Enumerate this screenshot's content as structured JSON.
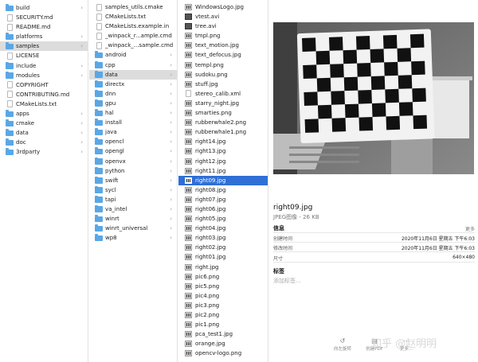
{
  "column1": [
    {
      "label": "build",
      "icon": "folder",
      "chevron": true
    },
    {
      "label": "SECURITY.md",
      "icon": "doc"
    },
    {
      "label": "README.md",
      "icon": "doc"
    },
    {
      "label": "platforms",
      "icon": "folder",
      "chevron": true
    },
    {
      "label": "samples",
      "icon": "folder",
      "chevron": true,
      "selected": "grey"
    },
    {
      "label": "LICENSE",
      "icon": "doc"
    },
    {
      "label": "include",
      "icon": "folder",
      "chevron": true
    },
    {
      "label": "modules",
      "icon": "folder",
      "chevron": true
    },
    {
      "label": "COPYRIGHT",
      "icon": "doc"
    },
    {
      "label": "CONTRIBUTING.md",
      "icon": "doc"
    },
    {
      "label": "CMakeLists.txt",
      "icon": "doc"
    },
    {
      "label": "apps",
      "icon": "folder",
      "chevron": true
    },
    {
      "label": "cmake",
      "icon": "folder",
      "chevron": true
    },
    {
      "label": "data",
      "icon": "folder",
      "chevron": true
    },
    {
      "label": "doc",
      "icon": "folder",
      "chevron": true
    },
    {
      "label": "3rdparty",
      "icon": "folder",
      "chevron": true
    }
  ],
  "column2": [
    {
      "label": "samples_utils.cmake",
      "icon": "doc"
    },
    {
      "label": "CMakeLists.txt",
      "icon": "doc"
    },
    {
      "label": "CMakeLists.example.in",
      "icon": "doc"
    },
    {
      "label": "_winpack_r...ample.cmd",
      "icon": "doc"
    },
    {
      "label": "_winpack_...sample.cmd",
      "icon": "doc"
    },
    {
      "label": "android",
      "icon": "folder",
      "chevron": true
    },
    {
      "label": "cpp",
      "icon": "folder",
      "chevron": true
    },
    {
      "label": "data",
      "icon": "folder",
      "chevron": true,
      "selected": "grey"
    },
    {
      "label": "directx",
      "icon": "folder",
      "chevron": true
    },
    {
      "label": "dnn",
      "icon": "folder",
      "chevron": true
    },
    {
      "label": "gpu",
      "icon": "folder",
      "chevron": true
    },
    {
      "label": "hal",
      "icon": "folder",
      "chevron": true
    },
    {
      "label": "install",
      "icon": "folder",
      "chevron": true
    },
    {
      "label": "java",
      "icon": "folder",
      "chevron": true
    },
    {
      "label": "opencl",
      "icon": "folder",
      "chevron": true
    },
    {
      "label": "opengl",
      "icon": "folder",
      "chevron": true
    },
    {
      "label": "openvx",
      "icon": "folder",
      "chevron": true
    },
    {
      "label": "python",
      "icon": "folder",
      "chevron": true
    },
    {
      "label": "swift",
      "icon": "folder",
      "chevron": true
    },
    {
      "label": "sycl",
      "icon": "folder",
      "chevron": true
    },
    {
      "label": "tapi",
      "icon": "folder",
      "chevron": true
    },
    {
      "label": "va_intel",
      "icon": "folder",
      "chevron": true
    },
    {
      "label": "winrt",
      "icon": "folder",
      "chevron": true
    },
    {
      "label": "winrt_universal",
      "icon": "folder",
      "chevron": true
    },
    {
      "label": "wp8",
      "icon": "folder",
      "chevron": true
    }
  ],
  "column3": [
    {
      "label": "WindowsLogo.jpg",
      "icon": "img"
    },
    {
      "label": "vtest.avi",
      "icon": "vid"
    },
    {
      "label": "tree.avi",
      "icon": "vid"
    },
    {
      "label": "tmpl.png",
      "icon": "img"
    },
    {
      "label": "text_motion.jpg",
      "icon": "img"
    },
    {
      "label": "text_defocus.jpg",
      "icon": "img"
    },
    {
      "label": "templ.png",
      "icon": "img"
    },
    {
      "label": "sudoku.png",
      "icon": "img"
    },
    {
      "label": "stuff.jpg",
      "icon": "img"
    },
    {
      "label": "stereo_calib.xml",
      "icon": "doc"
    },
    {
      "label": "starry_night.jpg",
      "icon": "img"
    },
    {
      "label": "smarties.png",
      "icon": "img"
    },
    {
      "label": "rubberwhale2.png",
      "icon": "img"
    },
    {
      "label": "rubberwhale1.png",
      "icon": "img"
    },
    {
      "label": "right14.jpg",
      "icon": "img"
    },
    {
      "label": "right13.jpg",
      "icon": "img"
    },
    {
      "label": "right12.jpg",
      "icon": "img"
    },
    {
      "label": "right11.jpg",
      "icon": "img"
    },
    {
      "label": "right09.jpg",
      "icon": "img",
      "selected": "blue"
    },
    {
      "label": "right08.jpg",
      "icon": "img"
    },
    {
      "label": "right07.jpg",
      "icon": "img"
    },
    {
      "label": "right06.jpg",
      "icon": "img"
    },
    {
      "label": "right05.jpg",
      "icon": "img"
    },
    {
      "label": "right04.jpg",
      "icon": "img"
    },
    {
      "label": "right03.jpg",
      "icon": "img"
    },
    {
      "label": "right02.jpg",
      "icon": "img"
    },
    {
      "label": "right01.jpg",
      "icon": "img"
    },
    {
      "label": "right.jpg",
      "icon": "img"
    },
    {
      "label": "pic6.png",
      "icon": "img"
    },
    {
      "label": "pic5.png",
      "icon": "img"
    },
    {
      "label": "pic4.png",
      "icon": "img"
    },
    {
      "label": "pic3.png",
      "icon": "img"
    },
    {
      "label": "pic2.png",
      "icon": "img"
    },
    {
      "label": "pic1.png",
      "icon": "img"
    },
    {
      "label": "pca_test1.jpg",
      "icon": "img"
    },
    {
      "label": "orange.jpg",
      "icon": "img"
    },
    {
      "label": "opencv-logo.png",
      "icon": "img"
    }
  ],
  "preview": {
    "file_name": "right09.jpg",
    "file_kind": "JPEG图像 - 26 KB",
    "info_heading": "信息",
    "more_label": "更多",
    "rows": [
      {
        "key": "创建时间",
        "value": "2020年11月6日 星期五 下午6:03"
      },
      {
        "key": "修改时间",
        "value": "2020年11月6日 星期五 下午6:03"
      },
      {
        "key": "尺寸",
        "value": "640×480"
      }
    ],
    "tags_heading": "标签",
    "tags_placeholder": "添加标签...",
    "actions": [
      {
        "icon": "rotate-left-icon",
        "glyph": "↺",
        "label": "向左旋转"
      },
      {
        "icon": "pdf-icon",
        "glyph": "▤",
        "label": "创建PDF"
      },
      {
        "icon": "more-icon",
        "glyph": "⋯",
        "label": "更多..."
      }
    ],
    "watermark": "知乎 @赵明明"
  }
}
